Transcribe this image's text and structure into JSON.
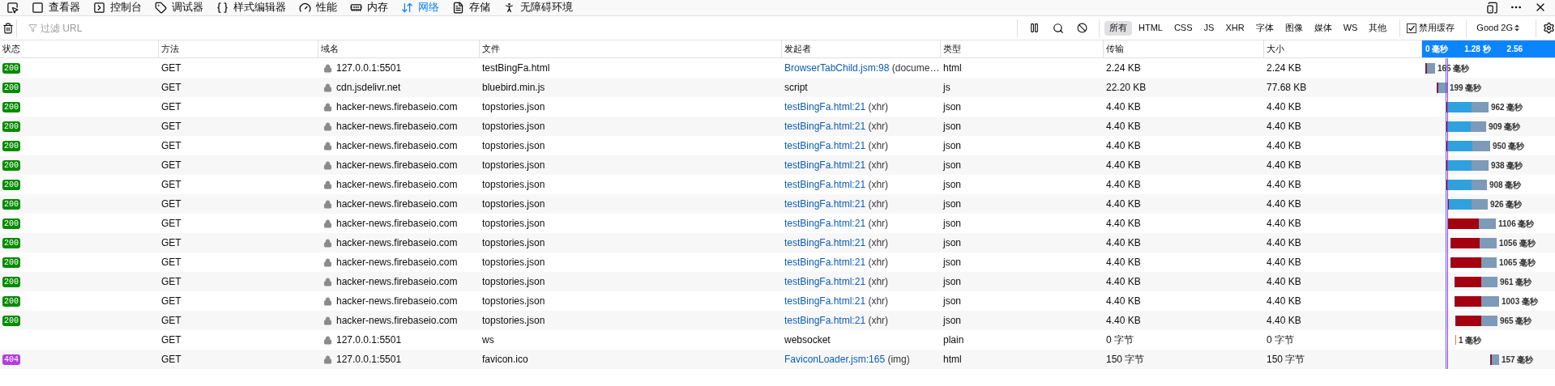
{
  "tabs": [
    {
      "kind": "picker",
      "selected": false
    },
    {
      "kind": "inspector",
      "label": "查看器",
      "selected": false
    },
    {
      "kind": "console",
      "label": "控制台",
      "selected": false
    },
    {
      "kind": "debugger",
      "label": "调试器",
      "selected": false
    },
    {
      "kind": "style",
      "label": "样式编辑器",
      "selected": false
    },
    {
      "kind": "performance",
      "label": "性能",
      "selected": false
    },
    {
      "kind": "memory",
      "label": "内存",
      "selected": false
    },
    {
      "kind": "network",
      "label": "网络",
      "selected": true
    },
    {
      "kind": "storage",
      "label": "存储",
      "selected": false
    },
    {
      "kind": "accessibility",
      "label": "无障碍环境",
      "selected": false
    }
  ],
  "filter": {
    "placeholder": "过滤 URL",
    "types": [
      {
        "label": "所有",
        "selected": true
      },
      {
        "label": "HTML",
        "selected": false
      },
      {
        "label": "CSS",
        "selected": false
      },
      {
        "label": "JS",
        "selected": false
      },
      {
        "label": "XHR",
        "selected": false
      },
      {
        "label": "字体",
        "selected": false
      },
      {
        "label": "图像",
        "selected": false
      },
      {
        "label": "媒体",
        "selected": false
      },
      {
        "label": "WS",
        "selected": false
      },
      {
        "label": "其他",
        "selected": false
      }
    ],
    "disable_cache": {
      "label": "禁用缓存",
      "checked": true
    },
    "throttle": "Good 2G"
  },
  "table": {
    "columns": [
      "状态",
      "方法",
      "域名",
      "文件",
      "发起者",
      "类型",
      "传输",
      "大小"
    ],
    "timeline": [
      "0 毫秒",
      "1.28 秒",
      "2.56"
    ],
    "rows": [
      {
        "status": "200",
        "color": "#058b00",
        "method": "GET",
        "domain": "127.0.0.1:5501",
        "file": "testBingFa.html",
        "initiator": {
          "link": "BrowserTabChild.jsm:98",
          "cause": " (docume…"
        },
        "type": "html",
        "transferred": "2.24 KB",
        "size": "2.24 KB",
        "duration": "165 毫秒"
      },
      {
        "status": "200",
        "color": "#058b00",
        "method": "GET",
        "domain": "cdn.jsdelivr.net",
        "file": "bluebird.min.js",
        "initiator": {
          "text": "script"
        },
        "type": "js",
        "transferred": "22.20 KB",
        "size": "77.68 KB",
        "duration": "199 毫秒"
      },
      {
        "status": "200",
        "color": "#058b00",
        "method": "GET",
        "domain": "hacker-news.firebaseio.com",
        "file": "topstories.json",
        "initiator": {
          "link": "testBingFa.html:21",
          "cause": " (xhr)"
        },
        "type": "json",
        "transferred": "4.40 KB",
        "size": "4.40 KB",
        "duration": "962 毫秒"
      },
      {
        "status": "200",
        "color": "#058b00",
        "method": "GET",
        "domain": "hacker-news.firebaseio.com",
        "file": "topstories.json",
        "initiator": {
          "link": "testBingFa.html:21",
          "cause": " (xhr)"
        },
        "type": "json",
        "transferred": "4.40 KB",
        "size": "4.40 KB",
        "duration": "909 毫秒"
      },
      {
        "status": "200",
        "color": "#058b00",
        "method": "GET",
        "domain": "hacker-news.firebaseio.com",
        "file": "topstories.json",
        "initiator": {
          "link": "testBingFa.html:21",
          "cause": " (xhr)"
        },
        "type": "json",
        "transferred": "4.40 KB",
        "size": "4.40 KB",
        "duration": "950 毫秒"
      },
      {
        "status": "200",
        "color": "#058b00",
        "method": "GET",
        "domain": "hacker-news.firebaseio.com",
        "file": "topstories.json",
        "initiator": {
          "link": "testBingFa.html:21",
          "cause": " (xhr)"
        },
        "type": "json",
        "transferred": "4.40 KB",
        "size": "4.40 KB",
        "duration": "938 毫秒"
      },
      {
        "status": "200",
        "color": "#058b00",
        "method": "GET",
        "domain": "hacker-news.firebaseio.com",
        "file": "topstories.json",
        "initiator": {
          "link": "testBingFa.html:21",
          "cause": " (xhr)"
        },
        "type": "json",
        "transferred": "4.40 KB",
        "size": "4.40 KB",
        "duration": "908 毫秒"
      },
      {
        "status": "200",
        "color": "#058b00",
        "method": "GET",
        "domain": "hacker-news.firebaseio.com",
        "file": "topstories.json",
        "initiator": {
          "link": "testBingFa.html:21",
          "cause": " (xhr)"
        },
        "type": "json",
        "transferred": "4.40 KB",
        "size": "4.40 KB",
        "duration": "926 毫秒"
      },
      {
        "status": "200",
        "color": "#058b00",
        "method": "GET",
        "domain": "hacker-news.firebaseio.com",
        "file": "topstories.json",
        "initiator": {
          "link": "testBingFa.html:21",
          "cause": " (xhr)"
        },
        "type": "json",
        "transferred": "4.40 KB",
        "size": "4.40 KB",
        "duration": "1106 毫秒"
      },
      {
        "status": "200",
        "color": "#058b00",
        "method": "GET",
        "domain": "hacker-news.firebaseio.com",
        "file": "topstories.json",
        "initiator": {
          "link": "testBingFa.html:21",
          "cause": " (xhr)"
        },
        "type": "json",
        "transferred": "4.40 KB",
        "size": "4.40 KB",
        "duration": "1056 毫秒"
      },
      {
        "status": "200",
        "color": "#058b00",
        "method": "GET",
        "domain": "hacker-news.firebaseio.com",
        "file": "topstories.json",
        "initiator": {
          "link": "testBingFa.html:21",
          "cause": " (xhr)"
        },
        "type": "json",
        "transferred": "4.40 KB",
        "size": "4.40 KB",
        "duration": "1065 毫秒"
      },
      {
        "status": "200",
        "color": "#058b00",
        "method": "GET",
        "domain": "hacker-news.firebaseio.com",
        "file": "topstories.json",
        "initiator": {
          "link": "testBingFa.html:21",
          "cause": " (xhr)"
        },
        "type": "json",
        "transferred": "4.40 KB",
        "size": "4.40 KB",
        "duration": "961 毫秒"
      },
      {
        "status": "200",
        "color": "#058b00",
        "method": "GET",
        "domain": "hacker-news.firebaseio.com",
        "file": "topstories.json",
        "initiator": {
          "link": "testBingFa.html:21",
          "cause": " (xhr)"
        },
        "type": "json",
        "transferred": "4.40 KB",
        "size": "4.40 KB",
        "duration": "1003 毫秒"
      },
      {
        "status": "200",
        "color": "#058b00",
        "method": "GET",
        "domain": "hacker-news.firebaseio.com",
        "file": "topstories.json",
        "initiator": {
          "link": "testBingFa.html:21",
          "cause": " (xhr)"
        },
        "type": "json",
        "transferred": "4.40 KB",
        "size": "4.40 KB",
        "duration": "965 毫秒"
      },
      {
        "method": "GET",
        "domain": "127.0.0.1:5501",
        "file": "ws",
        "initiator": {
          "text": "websocket"
        },
        "type": "plain",
        "transferred": "0 字节",
        "size": "0 字节",
        "duration": "1 毫秒"
      },
      {
        "status": "404",
        "color": "#b33de0",
        "method": "GET",
        "domain": "127.0.0.1:5501",
        "file": "favicon.ico",
        "initiator": {
          "link": "FaviconLoader.jsm:165",
          "cause": " (img)"
        },
        "type": "html",
        "transferred": "150 字节",
        "size": "150 字节",
        "duration": "157 毫秒"
      }
    ]
  }
}
